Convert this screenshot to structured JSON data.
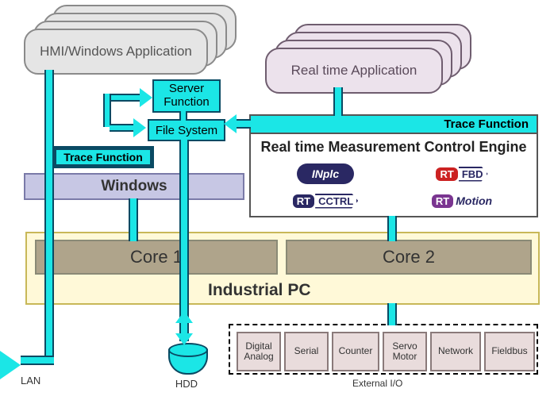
{
  "hmi": {
    "label": "HMI/Windows Application"
  },
  "realtime_app": {
    "label": "Real time Application"
  },
  "server": {
    "line1": "Server",
    "line2": "Function"
  },
  "filesystem": {
    "label": "File System"
  },
  "trace_left": {
    "label": "Trace Function"
  },
  "windows": {
    "label": "Windows"
  },
  "engine": {
    "trace_label": "Trace Function",
    "title": "Real time Measurement Control Engine",
    "badges": {
      "inplc": "INplc",
      "rtfbd_prefix": "RT",
      "rtfbd_suffix": "FBD",
      "rtcctrl_prefix": "RT",
      "rtcctrl_suffix": "CCTRL",
      "rtmotion_prefix": "RT",
      "rtmotion_suffix": "Motion"
    }
  },
  "ipc": {
    "label": "Industrial PC",
    "core1": "Core 1",
    "core2": "Core 2"
  },
  "hdd": {
    "label": "HDD"
  },
  "lan": {
    "label": "LAN"
  },
  "external_io": {
    "caption": "External I/O",
    "items": [
      "Digital\nAnalog",
      "Serial",
      "Counter",
      "Servo\nMotor",
      "Network",
      "Fieldbus"
    ]
  }
}
